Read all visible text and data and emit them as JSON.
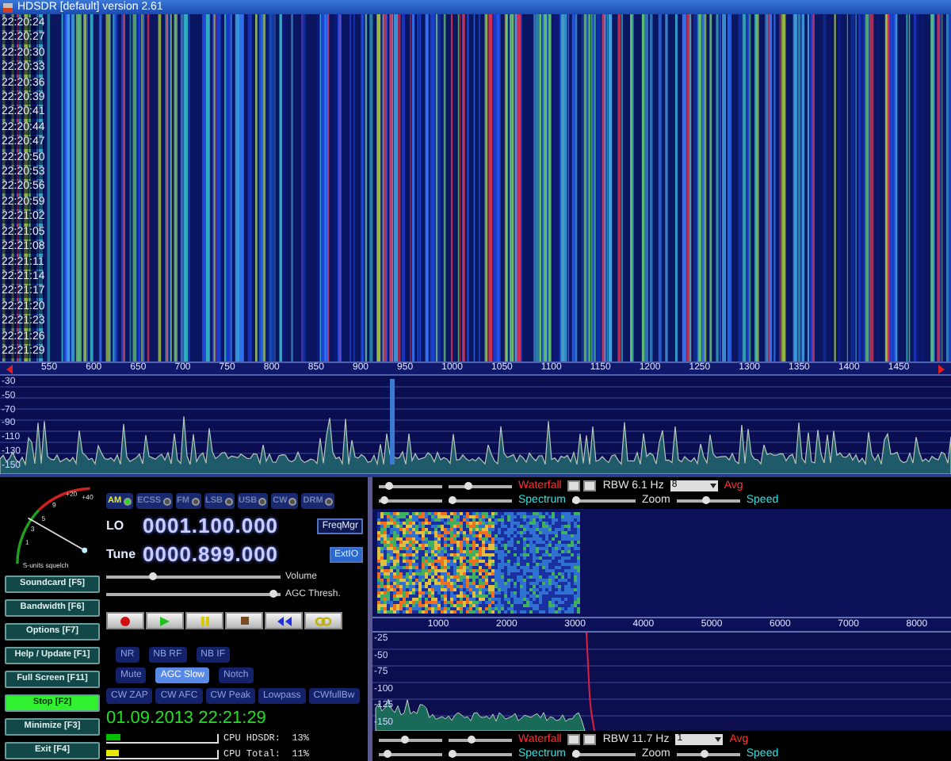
{
  "window": {
    "title": "HDSDR [default]  version 2.61"
  },
  "waterfall": {
    "times": [
      "22:20:24",
      "22:20:27",
      "22:20:30",
      "22:20:33",
      "22:20:36",
      "22:20:39",
      "22:20:41",
      "22:20:44",
      "22:20:47",
      "22:20:50",
      "22:20:53",
      "22:20:56",
      "22:20:59",
      "22:21:02",
      "22:21:05",
      "22:21:08",
      "22:21:11",
      "22:21:14",
      "22:21:17",
      "22:21:20",
      "22:21:23",
      "22:21:26",
      "22:21:29"
    ]
  },
  "frequency_scale": {
    "labels": [
      "550",
      "600",
      "650",
      "700",
      "750",
      "800",
      "850",
      "900",
      "950",
      "1000",
      "1050",
      "1100",
      "1150",
      "1200",
      "1250",
      "1300",
      "1350",
      "1400",
      "1450"
    ]
  },
  "spectrum": {
    "y_labels": [
      "-30",
      "-50",
      "-70",
      "-90",
      "-110",
      "-130",
      "-150"
    ]
  },
  "smeter": {
    "labels": [
      "+40",
      "+20",
      "9",
      "5",
      "3",
      "1"
    ],
    "caption": "S-units squelch"
  },
  "modes": [
    {
      "label": "AM",
      "selected": true
    },
    {
      "label": "ECSS",
      "selected": false
    },
    {
      "label": "FM",
      "selected": false
    },
    {
      "label": "LSB",
      "selected": false
    },
    {
      "label": "USB",
      "selected": false
    },
    {
      "label": "CW",
      "selected": false
    },
    {
      "label": "DRM",
      "selected": false
    }
  ],
  "lo": {
    "label": "LO",
    "frequency": "0001.100.000",
    "button": "FreqMgr"
  },
  "tune": {
    "label": "Tune",
    "frequency": "0000.899.000",
    "button": "ExtIO"
  },
  "sliders": [
    {
      "label": "Volume",
      "level": 0.26
    },
    {
      "label": "AGC Thresh.",
      "level": 0.95
    }
  ],
  "transport": [
    {
      "kind": "record"
    },
    {
      "kind": "play"
    },
    {
      "kind": "pause"
    },
    {
      "kind": "stop"
    },
    {
      "kind": "rewind"
    },
    {
      "kind": "loop"
    }
  ],
  "function_keys": [
    {
      "label": "Soundcard [F5]",
      "on": false
    },
    {
      "label": "Bandwidth [F6]",
      "on": false
    },
    {
      "label": "Options [F7]",
      "on": false
    },
    {
      "label": "Help / Update [F1]",
      "on": false
    },
    {
      "label": "Full Screen [F11]",
      "on": false
    },
    {
      "label": "Stop [F2]",
      "on": true
    },
    {
      "label": "Minimize [F3]",
      "on": false
    },
    {
      "label": "Exit [F4]",
      "on": false
    }
  ],
  "dsp": [
    [
      {
        "label": "NR",
        "on": false
      },
      {
        "label": "NB RF",
        "on": false
      },
      {
        "label": "NB IF",
        "on": false
      }
    ],
    [
      {
        "label": "Mute",
        "on": false
      },
      {
        "label": "AGC Slow",
        "on": true
      },
      {
        "label": "Notch",
        "on": false
      }
    ],
    [
      {
        "label": "CW ZAP",
        "on": false
      },
      {
        "label": "CW AFC",
        "on": false
      },
      {
        "label": "CW Peak",
        "on": false
      },
      {
        "label": "Lowpass",
        "on": false
      },
      {
        "label": "CWfullBw",
        "on": false
      }
    ]
  ],
  "clock": "01.09.2013 22:21:29",
  "cpu": [
    {
      "label": "CPU HDSDR:  13%",
      "level": 0.13,
      "color": "#00c000"
    },
    {
      "label": "CPU Total:  11%",
      "level": 0.11,
      "color": "#e8e800"
    }
  ],
  "audio_top_controls": {
    "sliders": [
      {
        "level": 0.15
      },
      {
        "level": 0.3
      },
      {
        "level": 0.08
      },
      {
        "level": 0.05
      },
      {
        "level": 0.05
      },
      {
        "level": 0.45
      }
    ],
    "waterfall_label": "Waterfall",
    "rbw": "RBW  6.1 Hz",
    "avg_value": "8",
    "avg_label": "Avg",
    "spectrum_label": "Spectrum",
    "zoom_label": "Zoom",
    "speed_label": "Speed"
  },
  "audio_scale": {
    "labels": [
      "1000",
      "2000",
      "3000",
      "4000",
      "5000",
      "6000",
      "7000",
      "8000"
    ]
  },
  "audio_spectrum": {
    "y_labels": [
      "-25",
      "-50",
      "-75",
      "-100",
      "-125",
      "-150"
    ]
  },
  "audio_bottom_controls": {
    "sliders": [
      {
        "level": 0.4
      },
      {
        "level": 0.35
      },
      {
        "level": 0.12
      },
      {
        "level": 0.06
      },
      {
        "level": 0.04
      },
      {
        "level": 0.42
      }
    ],
    "waterfall_label": "Waterfall",
    "rbw": "RBW  11.7 Hz",
    "avg_value": "1",
    "avg_label": "Avg",
    "spectrum_label": "Spectrum",
    "zoom_label": "Zoom",
    "speed_label": "Speed"
  }
}
